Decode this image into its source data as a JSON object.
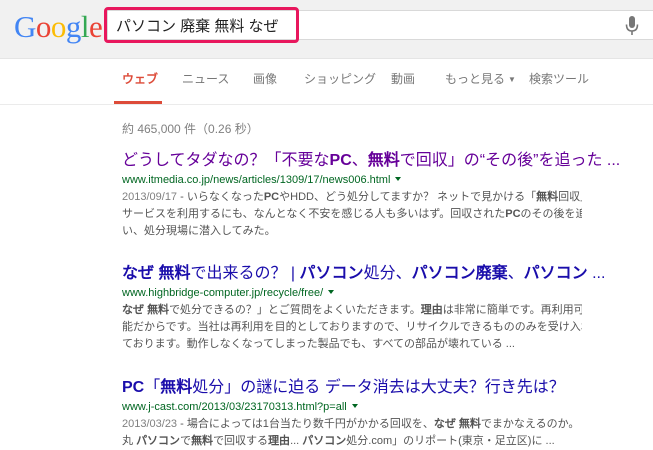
{
  "logo": {
    "letters": [
      {
        "ch": "G",
        "color": "#4285f4"
      },
      {
        "ch": "o",
        "color": "#ea4335"
      },
      {
        "ch": "o",
        "color": "#fbbc05"
      },
      {
        "ch": "g",
        "color": "#4285f4"
      },
      {
        "ch": "l",
        "color": "#34a853"
      },
      {
        "ch": "e",
        "color": "#ea4335"
      }
    ]
  },
  "search": {
    "value": "パソコン 廃棄 無料 なぜ"
  },
  "tabs": [
    {
      "label": "ウェブ",
      "active": true
    },
    {
      "label": "ニュース"
    },
    {
      "label": "画像"
    },
    {
      "label": "ショッピング"
    },
    {
      "label": "動画"
    },
    {
      "label": "もっと見る",
      "caret": "▼"
    },
    {
      "label": "検索ツール"
    }
  ],
  "stats": "約 465,000 件（0.26 秒）",
  "results": [
    {
      "title_parts": [
        {
          "t": "どうしてタダなの？「不要な"
        },
        {
          "t": "PC",
          "b": true
        },
        {
          "t": "、"
        },
        {
          "t": "無料",
          "b": true
        },
        {
          "t": "で回収」の“その後”を追った ..."
        }
      ],
      "url": "www.itmedia.co.jp/news/articles/1309/17/news006.html",
      "date": "2013/09/17",
      "snippet_lines": [
        [
          {
            "t": " - いらなくなった"
          },
          {
            "t": "PC",
            "b": true
          },
          {
            "t": "やHDD、どう処分してますか？ ネットで見かける「"
          },
          {
            "t": "無料",
            "b": true
          },
          {
            "t": "回収」"
          }
        ],
        [
          {
            "t": "サービスを利用するにも、なんとなく不安を感じる人も多いはず。回収された"
          },
          {
            "t": "PC",
            "b": true
          },
          {
            "t": "のその後を追"
          }
        ],
        [
          {
            "t": "い、処分現場に潜入してみた。"
          }
        ]
      ]
    },
    {
      "title_parts": [
        {
          "t": "なぜ",
          "b": true
        },
        {
          "t": " "
        },
        {
          "t": "無料",
          "b": true
        },
        {
          "t": "で出来るの？ | "
        },
        {
          "t": "パソコン",
          "b": true
        },
        {
          "t": "処分、"
        },
        {
          "t": "パソコン廃棄",
          "b": true
        },
        {
          "t": "、"
        },
        {
          "t": "パソコン",
          "b": true
        },
        {
          "t": " ..."
        }
      ],
      "url": "www.highbridge-computer.jp/recycle/free/",
      "date": "",
      "snippet_lines": [
        [
          {
            "t": "なぜ",
            "b": true
          },
          {
            "t": " "
          },
          {
            "t": "無料",
            "b": true
          },
          {
            "t": "で処分できるの？」とご質問をよくいただきます。"
          },
          {
            "t": "理由",
            "b": true
          },
          {
            "t": "は非常に簡単です。再利用可"
          }
        ],
        [
          {
            "t": "能だからです。当社は再利用を目的としておりますので、リサイクルできるもののみを受け入れ"
          }
        ],
        [
          {
            "t": "ております。動作しなくなってしまった製品でも、すべての部品が壊れている ..."
          }
        ]
      ]
    },
    {
      "title_parts": [
        {
          "t": "PC",
          "b": true
        },
        {
          "t": "「"
        },
        {
          "t": "無料",
          "b": true
        },
        {
          "t": "処分」の謎に迫る データ消去は大丈夫？行き先は？"
        }
      ],
      "url": "www.j-cast.com/2013/03/23170313.html?p=all",
      "date": "2013/03/23",
      "snippet_lines": [
        [
          {
            "t": " - 場合によっては1台当たり数千円がかかる回収を、"
          },
          {
            "t": "なぜ",
            "b": true
          },
          {
            "t": " "
          },
          {
            "t": "無料",
            "b": true
          },
          {
            "t": "でまかなえるのか。"
          }
        ],
        [
          {
            "t": "丸 "
          },
          {
            "t": "パソコン",
            "b": true
          },
          {
            "t": "で"
          },
          {
            "t": "無料",
            "b": true
          },
          {
            "t": "で回収する"
          },
          {
            "t": "理由",
            "b": true
          },
          {
            "t": "... "
          },
          {
            "t": "パソコン",
            "b": true
          },
          {
            "t": "処分.com」のリポート(東京・足立区)に ..."
          }
        ]
      ]
    }
  ]
}
